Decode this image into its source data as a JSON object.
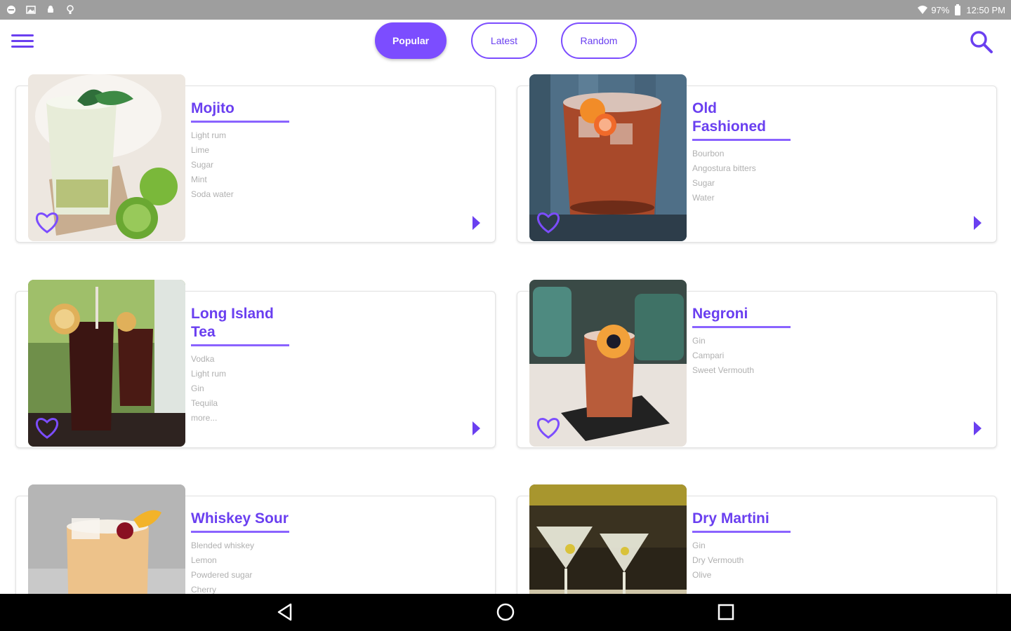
{
  "status_bar": {
    "battery": "97%",
    "time": "12:50 PM"
  },
  "header": {
    "tabs": [
      {
        "label": "Popular",
        "active": true
      },
      {
        "label": "Latest",
        "active": false
      },
      {
        "label": "Random",
        "active": false
      }
    ],
    "menu_icon": "hamburger-menu-icon",
    "search_icon": "search-icon"
  },
  "cocktails": [
    {
      "name_lines": [
        "Mojito"
      ],
      "ingredients": [
        "Light rum",
        "Lime",
        "Sugar",
        "Mint",
        "Soda water"
      ]
    },
    {
      "name_lines": [
        "Old",
        "Fashioned"
      ],
      "ingredients": [
        "Bourbon",
        "Angostura bitters",
        "Sugar",
        "Water"
      ]
    },
    {
      "name_lines": [
        "Long Island",
        "Tea"
      ],
      "ingredients": [
        "Vodka",
        "Light rum",
        "Gin",
        "Tequila",
        "more..."
      ]
    },
    {
      "name_lines": [
        "Negroni"
      ],
      "ingredients": [
        "Gin",
        "Campari",
        "Sweet Vermouth"
      ]
    },
    {
      "name_lines": [
        "Whiskey Sour"
      ],
      "ingredients": [
        "Blended whiskey",
        "Lemon",
        "Powdered sugar",
        "Cherry"
      ]
    },
    {
      "name_lines": [
        "Dry Martini"
      ],
      "ingredients": [
        "Gin",
        "Dry Vermouth",
        "Olive"
      ]
    }
  ],
  "colors": {
    "accent": "#7c4dff",
    "accent_text": "#6a3ff0",
    "ingredient_text": "#b0b0b0",
    "status_bar": "#9e9e9e",
    "nav_bar": "#000000"
  }
}
